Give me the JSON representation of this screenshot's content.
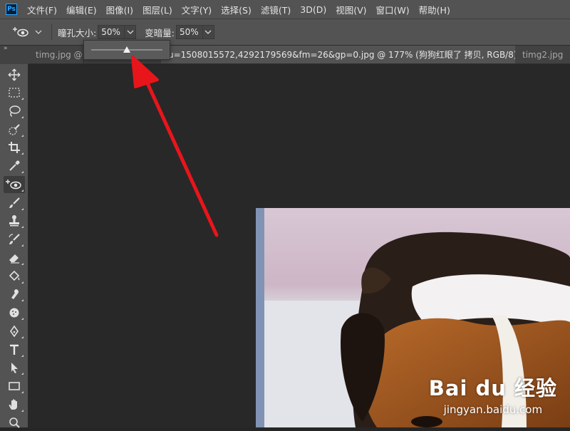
{
  "app": {
    "logo": "Ps"
  },
  "menu": [
    "文件(F)",
    "编辑(E)",
    "图像(I)",
    "图层(L)",
    "文字(Y)",
    "选择(S)",
    "滤镜(T)",
    "3D(D)",
    "视图(V)",
    "窗口(W)",
    "帮助(H)"
  ],
  "options": {
    "tool_icon": "red-eye-tool-icon",
    "pupil_size_label": "瞳孔大小:",
    "pupil_size_value": "50%",
    "darken_label": "变暗量:",
    "darken_value": "50%"
  },
  "slider_popup": {
    "value_fraction": 0.5
  },
  "tabs": [
    {
      "label": "timg.jpg @ 5",
      "active": false
    },
    {
      "label": "u=1508015572,4292179569&fm=26&gp=0.jpg @ 177% (狗狗红眼了 拷贝, RGB/8) *",
      "active": true,
      "close": "×"
    },
    {
      "label": "timg2.jpg",
      "active": false
    }
  ],
  "toolbar_collapse": "»",
  "tools": [
    "move-icon",
    "marquee-icon",
    "lasso-icon",
    "quick-select-icon",
    "crop-icon",
    "eyedropper-icon",
    "red-eye-icon",
    "brush-icon",
    "clone-stamp-icon",
    "history-brush-icon",
    "eraser-icon",
    "paint-bucket-icon",
    "smudge-icon",
    "sponge-icon",
    "pen-icon",
    "type-icon",
    "path-select-icon",
    "rectangle-icon",
    "hand-icon",
    "zoom-icon"
  ],
  "watermark": {
    "main": "Bai du 经验",
    "sub": "jingyan.baidu.com"
  },
  "colors": {
    "accent_arrow": "#e8151b",
    "ui_panel": "#535353",
    "canvas": "#282828"
  }
}
